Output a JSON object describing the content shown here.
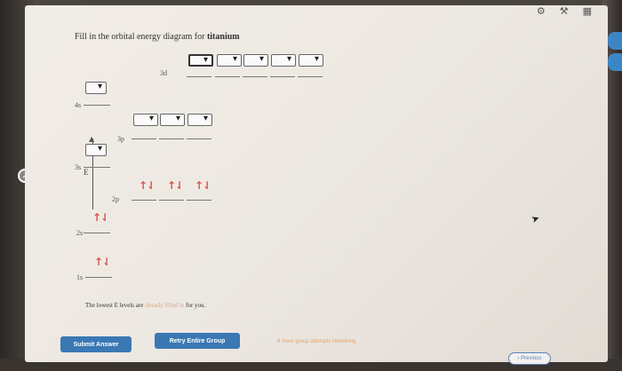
{
  "question": {
    "prefix": "Fill in the orbital energy diagram for ",
    "element": "titanium"
  },
  "levels": {
    "l3d": "3d",
    "l4s": "4s",
    "l3p": "3p",
    "l3s": "3s",
    "l2p": "2p",
    "l2s": "2s",
    "l1s": "1s"
  },
  "energy_axis_label": "E",
  "filled_orbitals": {
    "p2": [
      "↑⇃",
      "↑⇃",
      "↑⇃"
    ],
    "s2": "↑⇃",
    "s1": "↑⇃"
  },
  "note": {
    "part1": "The lowest E levels are ",
    "part2": "already filled in",
    "part3": " for you."
  },
  "buttons": {
    "submit": "Submit Answer",
    "retry": "Retry Entire Group"
  },
  "attempts_text": "8 more group attempts remaining",
  "previous": "Previous",
  "icons": [
    "gear-icon",
    "settings-icon",
    "grid-icon"
  ]
}
